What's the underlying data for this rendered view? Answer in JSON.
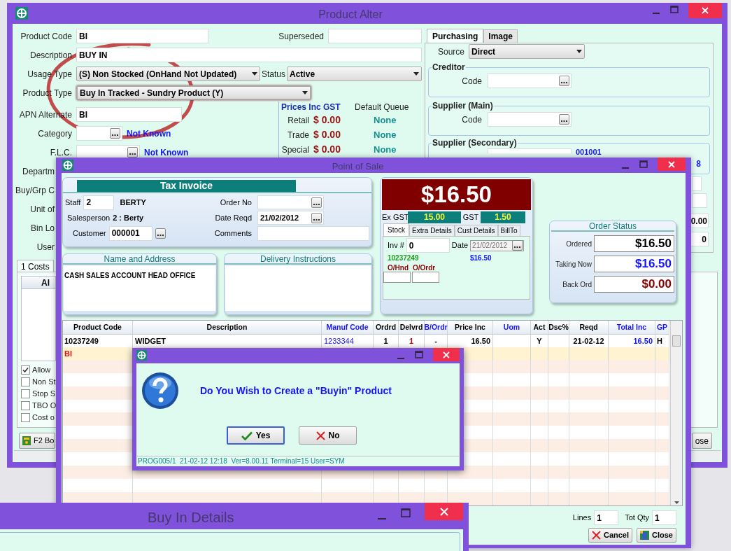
{
  "product_alter": {
    "title": "Product Alter",
    "product_code": {
      "label": "Product Code",
      "value": "BI"
    },
    "superseded": {
      "label": "Superseded"
    },
    "description": {
      "label": "Description",
      "value": "BUY IN"
    },
    "usage_type": {
      "label": "Usage Type",
      "value": "(S) Non Stocked (OnHand Not Updated)"
    },
    "status": {
      "label": "Status",
      "value": "Active"
    },
    "product_type": {
      "label": "Product Type",
      "value": "Buy In Tracked - Sundry Product (Y)"
    },
    "apn_alternate": {
      "label": "APN Alternate",
      "value": "BI"
    },
    "category": {
      "label": "Category",
      "link": "Not Known"
    },
    "flc": {
      "label": "F.L.C.",
      "link": "Not Known"
    },
    "cut_labels": [
      "Departm",
      "Buy/Grp C",
      "Unit of",
      "Bin Lo",
      "User"
    ],
    "prices": {
      "heading": "Prices Inc GST",
      "queue_heading": "Default Queue",
      "rows": [
        {
          "label": "Retail",
          "price": "$ 0.00",
          "queue": "None"
        },
        {
          "label": "Trade",
          "price": "$ 0.00",
          "queue": "None"
        },
        {
          "label": "Special",
          "price": "$ 0.00",
          "queue": "None"
        }
      ]
    },
    "purchasing_tabs": [
      {
        "label": "Purchasing",
        "selected": true
      },
      {
        "label": "Image",
        "selected": false
      }
    ],
    "source": {
      "label": "Source",
      "value": "Direct"
    },
    "creditor": {
      "title": "Creditor",
      "code_label": "Code"
    },
    "supplier_main": {
      "title": "Supplier (Main)",
      "code_label": "Code"
    },
    "supplier_secondary": {
      "title": "Supplier (Secondary)",
      "link": "001001",
      "link_tail": "8"
    },
    "amount": "0.00",
    "count": "0",
    "lower_tabs": [
      {
        "label": "1 Costs",
        "selected": true
      }
    ],
    "costs_column": "Al",
    "options": [
      {
        "label": "Allow",
        "checked": true
      },
      {
        "label": "Non St",
        "checked": false
      },
      {
        "label": "Stop S",
        "checked": false
      },
      {
        "label": "TBO O",
        "checked": false
      },
      {
        "label": "Cost o",
        "checked": false
      }
    ],
    "f2_button": "F2 Bo",
    "close_button": "ose"
  },
  "pos": {
    "title": "Point of Sale",
    "invoice": {
      "heading": "Tax Invoice",
      "staff_label": "Staff",
      "staff": "2",
      "staff_name": "BERTY",
      "salesperson_label": "Salesperson",
      "salesperson": "2 : Berty",
      "customer_label": "Customer",
      "customer": "000001",
      "order_no_label": "Order No",
      "date_label": "Date Reqd",
      "date": "21/02/2012",
      "comments_label": "Comments"
    },
    "name_address": {
      "heading": "Name and Address",
      "text": "CASH SALES ACCOUNT HEAD OFFICE"
    },
    "delivery": {
      "heading": "Delivery Instructions"
    },
    "total": "$16.50",
    "ex_gst_label": "Ex GST",
    "ex_gst": "15.00",
    "gst_label": "GST",
    "gst": "1.50",
    "stock_tabs": [
      {
        "label": "Stock",
        "selected": true
      },
      {
        "label": "Extra Details",
        "selected": false
      },
      {
        "label": "Cust Details",
        "selected": false
      },
      {
        "label": "BillTo",
        "selected": false
      }
    ],
    "stock": {
      "inv_label": "Inv #",
      "inv": "0",
      "date_label": "Date",
      "date": "21/02/2012",
      "code": "10237249",
      "price": "$16.50",
      "onhand_label": "O/Hnd",
      "onorder_label": "O/Ordr"
    },
    "order_status": {
      "heading": "Order Status",
      "rows": [
        {
          "label": "Ordered",
          "value": "$16.50",
          "color": "#000000"
        },
        {
          "label": "Taking Now",
          "value": "$16.50",
          "color": "#1414ff"
        },
        {
          "label": "Back Ord",
          "value": "$0.00",
          "color": "#8b0000"
        }
      ]
    },
    "table": {
      "columns": [
        {
          "label": "Product Code",
          "color": "#000000"
        },
        {
          "label": "Description",
          "color": "#000000"
        },
        {
          "label": "Manuf Code",
          "color": "#1414ff"
        },
        {
          "label": "Ordrd",
          "color": "#000000"
        },
        {
          "label": "Delvrd",
          "color": "#000000"
        },
        {
          "label": "B/Ordr",
          "color": "#1414ff"
        },
        {
          "label": "Price Inc",
          "color": "#000000"
        },
        {
          "label": "Uom",
          "color": "#1414ff"
        },
        {
          "label": "Act",
          "color": "#000000"
        },
        {
          "label": "Dsc%",
          "color": "#000000"
        },
        {
          "label": "Reqd",
          "color": "#000000"
        },
        {
          "label": "Total Inc",
          "color": "#1414ff"
        },
        {
          "label": "GP",
          "color": "#1414ff"
        }
      ],
      "rows": [
        {
          "selected": false,
          "cells": [
            "10237249",
            "WIDGET",
            "1233344",
            "1",
            "1",
            "-",
            "16.50",
            "",
            "Y",
            "",
            "21-02-12",
            "16.50",
            "H"
          ]
        },
        {
          "selected": true,
          "cells": [
            "BI"
          ]
        }
      ]
    },
    "footer": {
      "lines_label": "Lines",
      "lines": "1",
      "tot_qty_label": "Tot Qty",
      "tot_qty": "1",
      "cancel": "Cancel",
      "close": "Close"
    }
  },
  "dialog": {
    "message": "Do You Wish to Create a \"Buyin\" Product",
    "buttons": [
      {
        "label": "Yes",
        "kind": "yes",
        "selected": true
      },
      {
        "label": "No",
        "kind": "no",
        "selected": false
      }
    ],
    "status": "PROG005/1  21-02-12 12:18  Ver=8.00.11 Terminal=15 User=SYM"
  },
  "buy_in": {
    "title": "Buy In Details"
  }
}
